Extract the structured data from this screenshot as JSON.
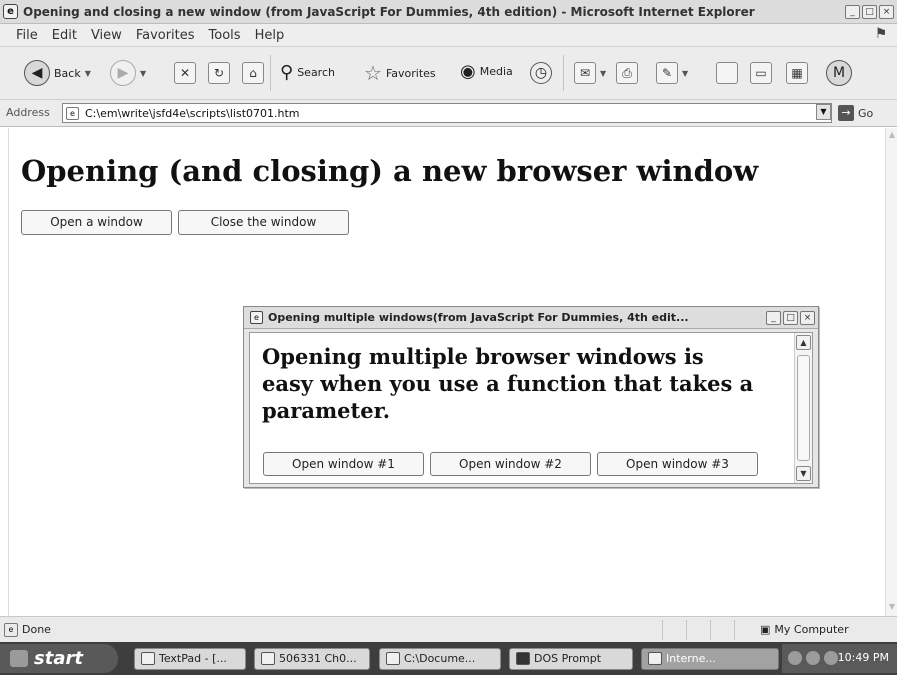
{
  "window": {
    "title": "Opening and closing a new window (from JavaScript For Dummies, 4th edition) - Microsoft Internet Explorer"
  },
  "menu": [
    "File",
    "Edit",
    "View",
    "Favorites",
    "Tools",
    "Help"
  ],
  "toolbar": {
    "back_label": "Back",
    "search_label": "Search",
    "favorites_label": "Favorites",
    "media_label": "Media"
  },
  "address": {
    "label": "Address",
    "url": "C:\\em\\write\\jsfd4e\\scripts\\list0701.htm",
    "go_label": "Go"
  },
  "page": {
    "heading": "Opening (and closing) a new browser window",
    "open_button": "Open a window",
    "close_button": "Close the window"
  },
  "popup": {
    "title": "Opening multiple windows(from JavaScript For Dummies, 4th edit...",
    "message": "Opening multiple browser windows is easy when you use a function that takes a parameter.",
    "buttons": [
      "Open window #1",
      "Open window #2",
      "Open window #3"
    ]
  },
  "status": {
    "text": "Done",
    "zone": "My Computer"
  },
  "taskbar": {
    "start_label": "start",
    "tasks": [
      "TextPad - [...",
      "506331 Ch0...",
      "C:\\Docume...",
      "DOS Prompt",
      "Interne..."
    ],
    "clock": "10:49 PM"
  }
}
